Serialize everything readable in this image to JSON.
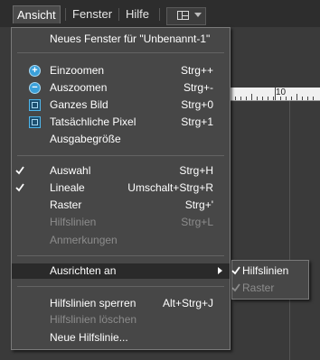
{
  "menubar": {
    "items": [
      {
        "label": "Ansicht"
      },
      {
        "label": "Fenster"
      },
      {
        "label": "Hilfe"
      }
    ]
  },
  "ruler": {
    "label": "10"
  },
  "menu": {
    "new_window": {
      "label": "Neues Fenster für \"Unbenannt-1\""
    },
    "zoom_in": {
      "label": "Einzoomen",
      "shortcut": "Strg++"
    },
    "zoom_out": {
      "label": "Auszoomen",
      "shortcut": "Strg+-"
    },
    "fit_screen": {
      "label": "Ganzes Bild",
      "shortcut": "Strg+0"
    },
    "actual_pixels": {
      "label": "Tatsächliche Pixel",
      "shortcut": "Strg+1"
    },
    "print_size": {
      "label": "Ausgabegröße"
    },
    "selection": {
      "label": "Auswahl",
      "shortcut": "Strg+H",
      "checked": true
    },
    "rulers": {
      "label": "Lineale",
      "shortcut": "Umschalt+Strg+R",
      "checked": true
    },
    "grid": {
      "label": "Raster",
      "shortcut": "Strg+'"
    },
    "guides": {
      "label": "Hilfslinien",
      "shortcut": "Strg+L",
      "disabled": true
    },
    "annotations": {
      "label": "Anmerkungen",
      "disabled": true
    },
    "snap_to": {
      "label": "Ausrichten an"
    },
    "lock_guides": {
      "label": "Hilfslinien sperren",
      "shortcut": "Alt+Strg+J"
    },
    "clear_guides": {
      "label": "Hilfslinien löschen",
      "disabled": true
    },
    "new_guide": {
      "label": "Neue Hilfslinie..."
    }
  },
  "submenu": {
    "guides": {
      "label": "Hilfslinien",
      "checked": true
    },
    "grid": {
      "label": "Raster",
      "checked": true,
      "disabled": true
    }
  },
  "colors": {
    "menu_bg": "#474747",
    "highlight_bg": "#2a2a2a",
    "disabled_text": "#8c8c8c",
    "icon_accent": "#3aa0da"
  }
}
